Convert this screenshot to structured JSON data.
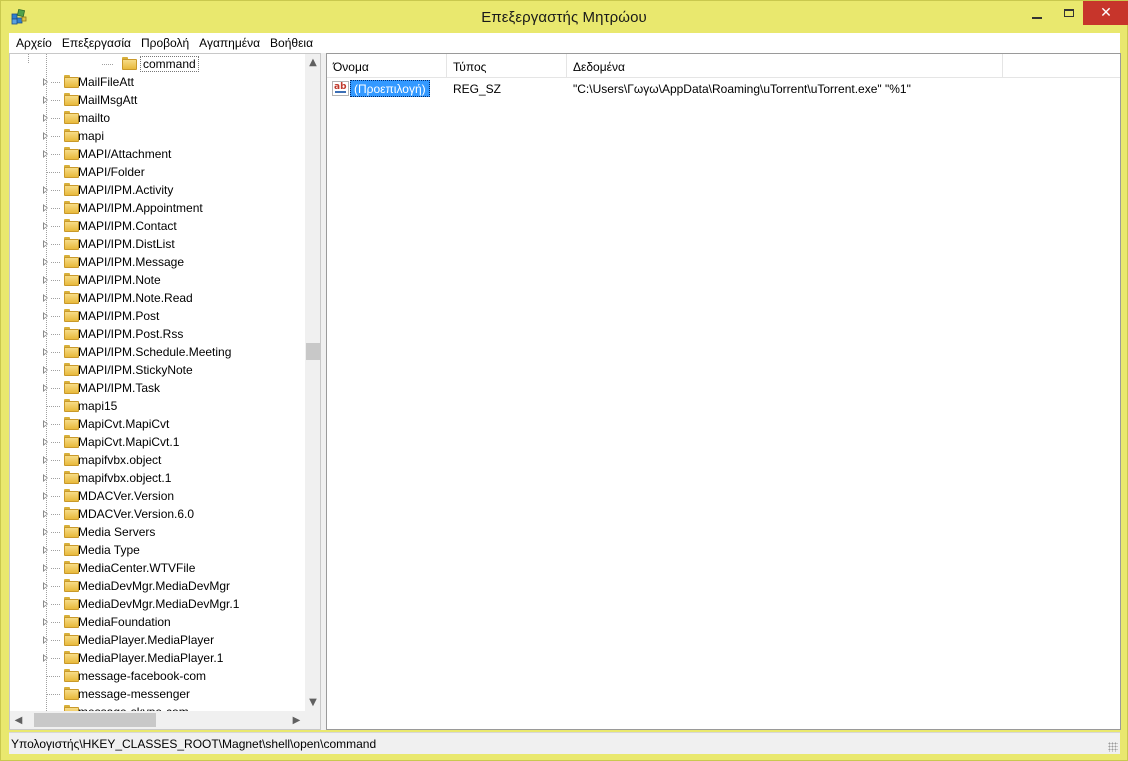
{
  "window": {
    "title": "Επεξεργαστής Μητρώου"
  },
  "menu": [
    "Αρχείο",
    "Επεξεργασία",
    "Προβολή",
    "Αγαπημένα",
    "Βοήθεια"
  ],
  "tree": {
    "selected": "command",
    "items": [
      {
        "label": "MailFileAtt",
        "expandable": true
      },
      {
        "label": "MailMsgAtt",
        "expandable": true
      },
      {
        "label": "mailto",
        "expandable": true
      },
      {
        "label": "mapi",
        "expandable": true
      },
      {
        "label": "MAPI/Attachment",
        "expandable": true
      },
      {
        "label": "MAPI/Folder",
        "expandable": false
      },
      {
        "label": "MAPI/IPM.Activity",
        "expandable": true
      },
      {
        "label": "MAPI/IPM.Appointment",
        "expandable": true
      },
      {
        "label": "MAPI/IPM.Contact",
        "expandable": true
      },
      {
        "label": "MAPI/IPM.DistList",
        "expandable": true
      },
      {
        "label": "MAPI/IPM.Message",
        "expandable": true
      },
      {
        "label": "MAPI/IPM.Note",
        "expandable": true
      },
      {
        "label": "MAPI/IPM.Note.Read",
        "expandable": true
      },
      {
        "label": "MAPI/IPM.Post",
        "expandable": true
      },
      {
        "label": "MAPI/IPM.Post.Rss",
        "expandable": true
      },
      {
        "label": "MAPI/IPM.Schedule.Meeting",
        "expandable": true
      },
      {
        "label": "MAPI/IPM.StickyNote",
        "expandable": true
      },
      {
        "label": "MAPI/IPM.Task",
        "expandable": true
      },
      {
        "label": "mapi15",
        "expandable": false
      },
      {
        "label": "MapiCvt.MapiCvt",
        "expandable": true
      },
      {
        "label": "MapiCvt.MapiCvt.1",
        "expandable": true
      },
      {
        "label": "mapifvbx.object",
        "expandable": true
      },
      {
        "label": "mapifvbx.object.1",
        "expandable": true
      },
      {
        "label": "MDACVer.Version",
        "expandable": true
      },
      {
        "label": "MDACVer.Version.6.0",
        "expandable": true
      },
      {
        "label": "Media Servers",
        "expandable": true
      },
      {
        "label": "Media Type",
        "expandable": true
      },
      {
        "label": "MediaCenter.WTVFile",
        "expandable": true
      },
      {
        "label": "MediaDevMgr.MediaDevMgr",
        "expandable": true
      },
      {
        "label": "MediaDevMgr.MediaDevMgr.1",
        "expandable": true
      },
      {
        "label": "MediaFoundation",
        "expandable": true
      },
      {
        "label": "MediaPlayer.MediaPlayer",
        "expandable": true
      },
      {
        "label": "MediaPlayer.MediaPlayer.1",
        "expandable": true
      },
      {
        "label": "message-facebook-com",
        "expandable": false
      },
      {
        "label": "message-messenger",
        "expandable": false
      },
      {
        "label": "message-skype-com",
        "expandable": false
      }
    ]
  },
  "list": {
    "columns": [
      "Όνομα",
      "Τύπος",
      "Δεδομένα"
    ],
    "rows": [
      {
        "name": "(Προεπιλογή)",
        "type": "REG_SZ",
        "data": "\"C:\\Users\\Γωγω\\AppData\\Roaming\\uTorrent\\uTorrent.exe\" \"%1\""
      }
    ]
  },
  "status": {
    "path": "Υπολογιστής\\HKEY_CLASSES_ROOT\\Magnet\\shell\\open\\command"
  },
  "colors": {
    "titlebar": "#e9e86e",
    "close_button": "#c7352b",
    "selection": "#3399ff"
  }
}
